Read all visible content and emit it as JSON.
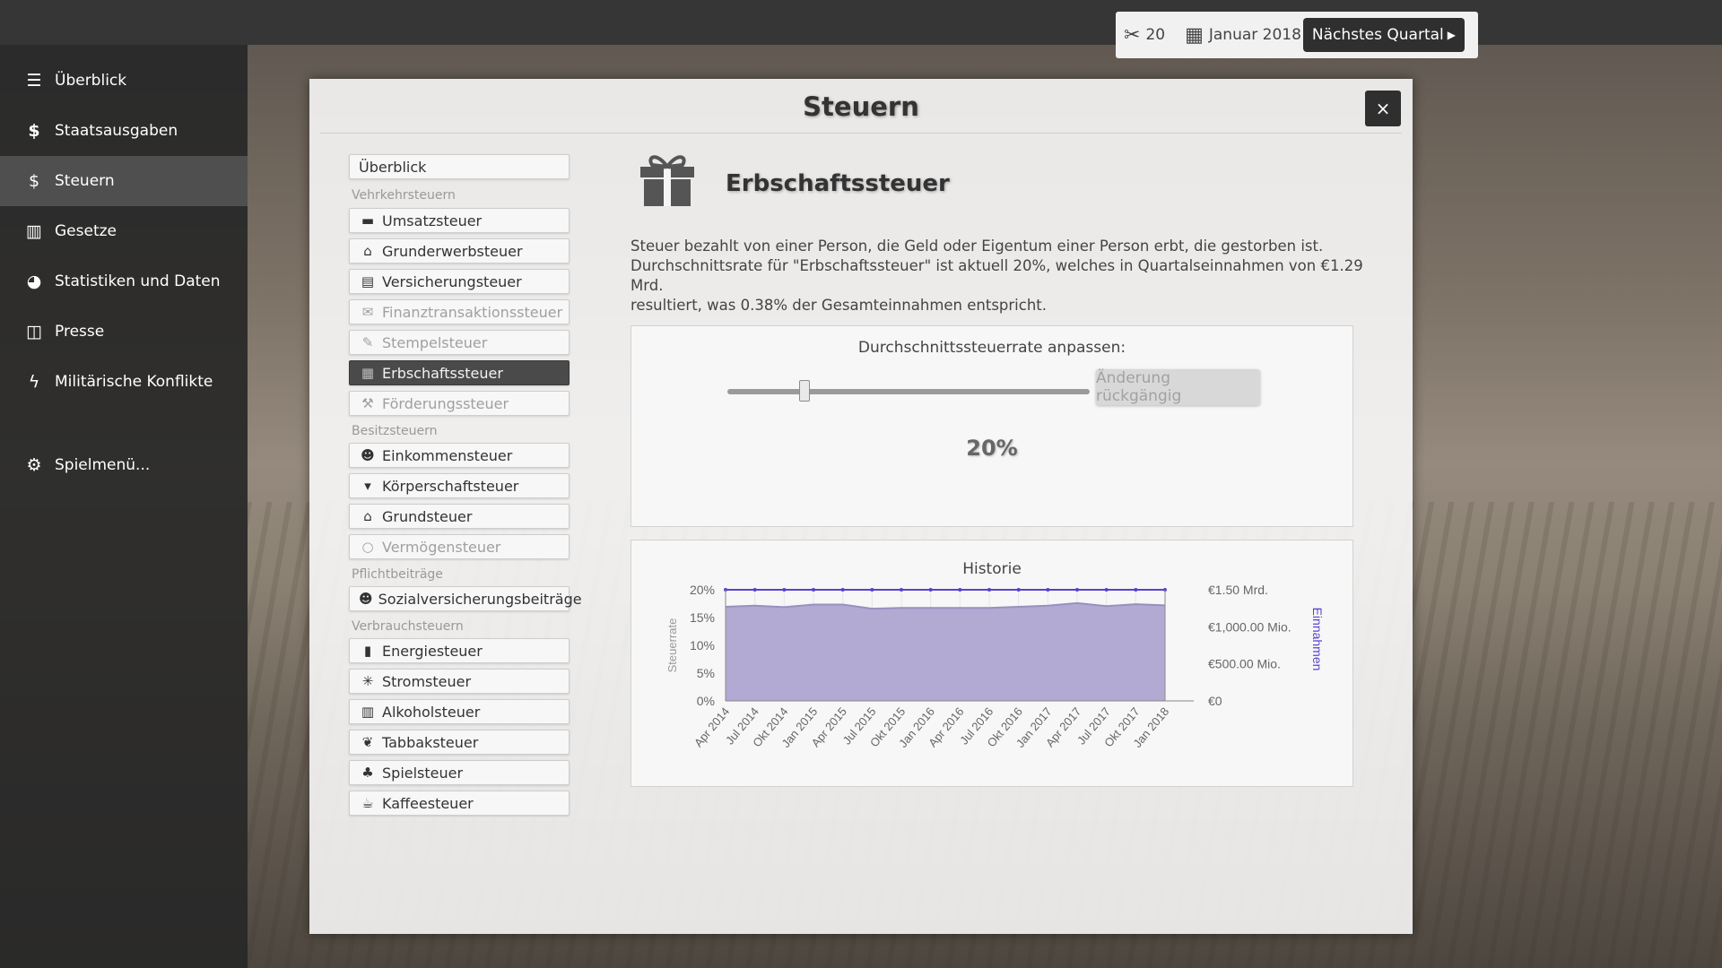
{
  "sidebar": {
    "items": [
      {
        "label": "Überblick",
        "icon": "newspaper-icon"
      },
      {
        "label": "Staatsausgaben",
        "icon": "dollar-icon"
      },
      {
        "label": "Steuern",
        "icon": "coin-icon",
        "active": true
      },
      {
        "label": "Gesetze",
        "icon": "book-icon"
      },
      {
        "label": "Statistiken und Daten",
        "icon": "pie-chart-icon"
      },
      {
        "label": "Presse",
        "icon": "open-book-icon"
      },
      {
        "label": "Militärische Konflikte",
        "icon": "lightning-icon"
      }
    ],
    "menu": {
      "label": "Spielmenü...",
      "icon": "gear-icon"
    }
  },
  "status": {
    "actions": "20",
    "date": "Januar 2018",
    "next_quarter": "Nächstes Quartal"
  },
  "modal": {
    "title": "Steuern",
    "close": "×"
  },
  "tax_nav": {
    "overview": "Überblick",
    "groups": [
      {
        "label": "Vehrkehrsteuern",
        "items": [
          {
            "label": "Umsatzsteuer",
            "icon": "card-icon",
            "state": "normal"
          },
          {
            "label": "Grunderwerbsteuer",
            "icon": "house-icon",
            "state": "normal"
          },
          {
            "label": "Versicherungsteuer",
            "icon": "document-icon",
            "state": "normal"
          },
          {
            "label": "Finanztransaktionssteuer",
            "icon": "money-icon",
            "state": "disabled"
          },
          {
            "label": "Stempelsteuer",
            "icon": "stamp-icon",
            "state": "disabled"
          },
          {
            "label": "Erbschaftssteuer",
            "icon": "gift-icon",
            "state": "active"
          },
          {
            "label": "Förderungssteuer",
            "icon": "crane-icon",
            "state": "disabled"
          }
        ]
      },
      {
        "label": "Besitzsteuern",
        "items": [
          {
            "label": "Einkommensteuer",
            "icon": "person-icon",
            "state": "normal"
          },
          {
            "label": "Körperschaftsteuer",
            "icon": "tie-icon",
            "state": "normal"
          },
          {
            "label": "Grundsteuer",
            "icon": "house-icon",
            "state": "normal"
          },
          {
            "label": "Vermögensteuer",
            "icon": "ring-icon",
            "state": "disabled"
          }
        ]
      },
      {
        "label": "Pflichtbeiträge",
        "items": [
          {
            "label": "Sozialversicherungsbeiträge",
            "icon": "people-icon",
            "state": "normal"
          }
        ]
      },
      {
        "label": "Verbrauchsteuern",
        "items": [
          {
            "label": "Energiesteuer",
            "icon": "fuel-icon",
            "state": "normal"
          },
          {
            "label": "Stromsteuer",
            "icon": "spark-icon",
            "state": "normal"
          },
          {
            "label": "Alkoholsteuer",
            "icon": "beer-icon",
            "state": "normal"
          },
          {
            "label": "Tabbaksteuer",
            "icon": "leaf-icon",
            "state": "normal"
          },
          {
            "label": "Spielsteuer",
            "icon": "club-icon",
            "state": "normal"
          },
          {
            "label": "Kaffeesteuer",
            "icon": "coffee-icon",
            "state": "normal"
          }
        ]
      }
    ]
  },
  "detail": {
    "title": "Erbschaftssteuer",
    "icon": "gift-icon",
    "desc_line1": "Steuer bezahlt von einer Person, die Geld oder Eigentum einer Person erbt, die gestorben ist.",
    "desc_line2": "Durchschnittsrate für \"Erbschaftssteuer\" ist aktuell 20%, welches in Quartalseinnahmen von  €1.29 Mrd.",
    "desc_line3": "resultiert, was 0.38% der Gesamteinnahmen entspricht.",
    "adjust_label": "Durchschnittssteuerrate anpassen:",
    "undo_button": "Änderung rückgängig",
    "rate_display": "20%",
    "slider_value": 20
  },
  "colors": {
    "rate_line": "#5b3fcf",
    "revenue_fill": "#b3aad3",
    "revenue_line": "#9a8fbf"
  },
  "chart_data": {
    "type": "area",
    "title": "Historie",
    "x": [
      "Apr 2014",
      "Jul 2014",
      "Okt 2014",
      "Jan 2015",
      "Apr 2015",
      "Jul 2015",
      "Okt 2015",
      "Jan 2016",
      "Apr 2016",
      "Jul 2016",
      "Okt 2016",
      "Jan 2017",
      "Apr 2017",
      "Jul 2017",
      "Okt 2017",
      "Jan 2018"
    ],
    "left_axis": {
      "label": "Steuerrate",
      "ticks": [
        "0%",
        "5%",
        "10%",
        "15%",
        "20%"
      ],
      "ylim": [
        0,
        20
      ]
    },
    "right_axis": {
      "label": "Einnahmen",
      "ticks": [
        "€0",
        "€500.00 Mio.",
        "€1,000.00 Mio.",
        "€1.50 Mrd."
      ],
      "ylim": [
        0,
        1500
      ]
    },
    "series": [
      {
        "axis": "left",
        "values": [
          20,
          20,
          20,
          20,
          20,
          20,
          20,
          20,
          20,
          20,
          20,
          20,
          20,
          20,
          20,
          20
        ]
      },
      {
        "axis": "right",
        "values": [
          1270,
          1285,
          1265,
          1300,
          1300,
          1245,
          1255,
          1255,
          1255,
          1255,
          1270,
          1285,
          1320,
          1280,
          1305,
          1290
        ]
      }
    ],
    "grid": true
  }
}
